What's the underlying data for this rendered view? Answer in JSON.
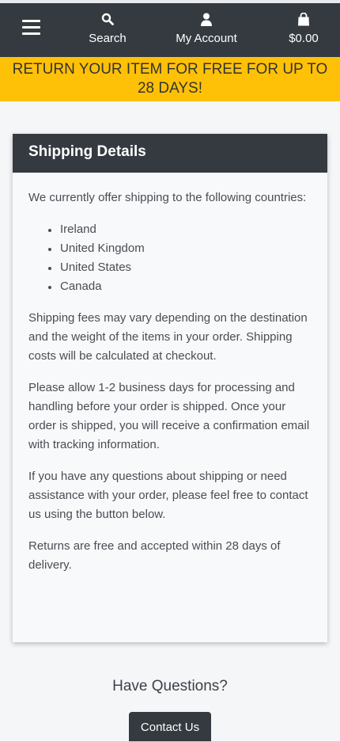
{
  "nav": {
    "menu_icon": "hamburger-icon",
    "search_label": "Search",
    "search_icon": "search-icon",
    "account_label": "My Account",
    "account_icon": "user-icon",
    "cart_label": "$0.00",
    "cart_icon": "shopping-bag-icon"
  },
  "banner": {
    "text": "RETURN YOUR ITEM FOR FREE FOR UP TO 28 DAYS!"
  },
  "shipping": {
    "title": "Shipping Details",
    "intro": "We currently offer shipping to the following countries:",
    "countries": [
      "Ireland",
      "United Kingdom",
      "United States",
      "Canada"
    ],
    "fees": "Shipping fees may vary depending on the destination and the weight of the items in your order. Shipping costs will be calculated at checkout.",
    "processing": "Please allow 1-2 business days for processing and handling before your order is shipped. Once your order is shipped, you will receive a confirmation email with tracking information.",
    "questions": "If you have any questions about shipping or need assistance with your order, please feel free to contact us using the button below.",
    "returns": "Returns are free and accepted within 28 days of delivery."
  },
  "contact": {
    "heading": "Have Questions?",
    "button_label": "Contact Us"
  },
  "colors": {
    "navbar": "#343a40",
    "banner": "#ffc107",
    "page_bg": "#f5f6f8"
  }
}
